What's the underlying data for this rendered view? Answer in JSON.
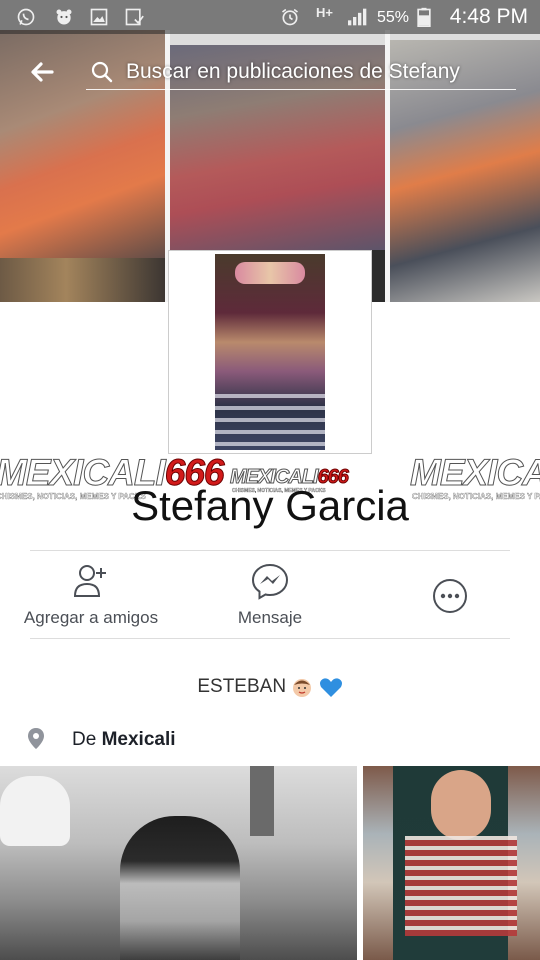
{
  "status_bar": {
    "battery_percent": "55%",
    "time": "4:48 PM",
    "network": "H+",
    "icons": [
      "whatsapp-icon",
      "bear-app-icon",
      "gallery-icon",
      "download-icon",
      "alarm-icon",
      "signal-icon",
      "battery-icon"
    ]
  },
  "search": {
    "placeholder": "Buscar en publicaciones de Stefany"
  },
  "watermark": {
    "part1": "MEXICALI",
    "part2": "666",
    "tagline": "CHISMES, NOTICIAS, MEMES Y PACKS"
  },
  "profile": {
    "name": "Stefany Garcia",
    "bio": "ESTEBAN",
    "location_prefix": "De",
    "location_city": "Mexicali"
  },
  "actions": [
    {
      "label": "Agregar a amigos",
      "icon": "add-friend-icon"
    },
    {
      "label": "Mensaje",
      "icon": "messenger-icon"
    },
    {
      "label": "",
      "icon": "more-icon"
    }
  ],
  "colors": {
    "brand_red": "#d21a1a",
    "bio_heart": "#2f8fe0",
    "text_dark": "#1d2129",
    "icon_gray": "#4b4f56"
  }
}
